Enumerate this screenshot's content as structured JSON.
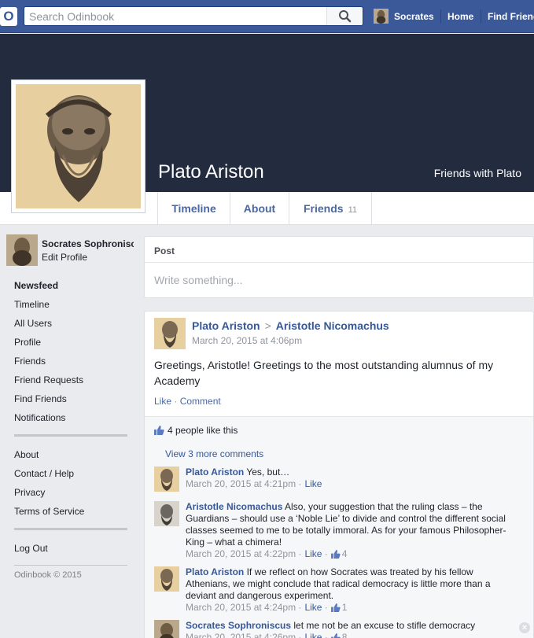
{
  "topbar": {
    "logo": "O",
    "search_placeholder": "Search Odinbook",
    "user_name": "Socrates",
    "home": "Home",
    "find_friends": "Find Friends"
  },
  "profile": {
    "name": "Plato Ariston",
    "friends_with": "Friends with Plato"
  },
  "tabs": {
    "timeline": "Timeline",
    "about": "About",
    "friends": "Friends",
    "friends_count": "11"
  },
  "sidebar": {
    "user_name": "Socrates Sophroniscus",
    "edit_profile": "Edit Profile",
    "nav": [
      "Newsfeed",
      "Timeline",
      "All Users",
      "Profile",
      "Friends",
      "Friend Requests",
      "Find Friends",
      "Notifications"
    ],
    "info": [
      "About",
      "Contact / Help",
      "Privacy",
      "Terms of Service"
    ],
    "logout": "Log Out",
    "copyright": "Odinbook © 2015"
  },
  "postbox": {
    "title": "Post",
    "placeholder": "Write something..."
  },
  "story": {
    "author": "Plato Ariston",
    "arrow": ">",
    "recipient": "Aristotle Nicomachus",
    "date": "March 20, 2015 at 4:06pm",
    "text": "Greetings, Aristotle! Greetings to the most outstanding alumnus of my Academy",
    "like": "Like",
    "comment": "Comment",
    "likes_text": "4 people like this",
    "more_comments": "View 3 more comments"
  },
  "comments": [
    {
      "author": "Plato Ariston",
      "text": "Yes, but…",
      "date": "March 20, 2015 at 4:21pm",
      "like": "Like",
      "likes": ""
    },
    {
      "author": "Aristotle Nicomachus",
      "text": "Also, your suggestion that the ruling class – the Guardians – should use a ‘Noble Lie’ to divide and control the different social classes seemed to me to be totally immoral. As for your famous Philosopher-King – what a chimera!",
      "date": "March 20, 2015 at 4:22pm",
      "like": "Like",
      "likes": "4"
    },
    {
      "author": "Plato Ariston",
      "text": "If we reflect on how Socrates was treated by his fellow Athenians, we might conclude that radical democracy is little more than a deviant and dangerous experiment.",
      "date": "March 20, 2015 at 4:24pm",
      "like": "Like",
      "likes": "1"
    },
    {
      "author": "Socrates Sophroniscus",
      "text": "let me not be an excuse to stifle democracy",
      "date": "March 20, 2015 at 4:26pm",
      "like": "Like",
      "likes": "8"
    }
  ],
  "colors": {
    "brand": "#3b5998",
    "cover": "#232b3f",
    "link": "#365899"
  }
}
